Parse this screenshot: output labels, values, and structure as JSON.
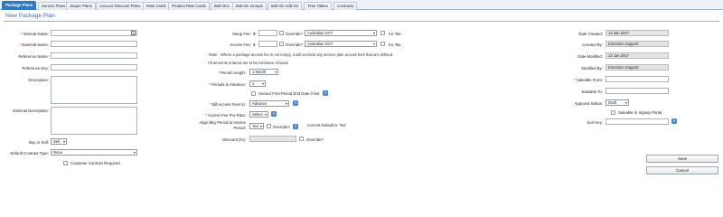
{
  "tabs": [
    "Package Plans",
    "Service Plans",
    "Jasper Plans",
    "Account Discount Plans",
    "Rate Cards",
    "Product Rate Cards",
    "Bolt-Ons",
    "Bolt-On Groups",
    "Bolt-On Add-On",
    "Time Tables",
    "Contracts"
  ],
  "page_title": "New Package Plan",
  "left": {
    "internal_name_label": "Internal Name:",
    "external_name_label": "External Name:",
    "reference_name_label": "Reference Name:",
    "reference_key_label": "Reference Key:",
    "description_label": "Description:",
    "external_description_label": "External Description:",
    "buy_or_sell_label": "Buy or Sell:",
    "buy_or_sell_value": "Sell",
    "default_contract_type_label": "Default Contract Type:",
    "default_contract_type_value": "None",
    "customer_contract_required_label": "Customer Contract Required"
  },
  "middle": {
    "setup_fee_label": "Setup Fee:",
    "access_fee_label": "Access Fee:",
    "currency_symbol": "$",
    "override_label": "Override?",
    "tax_value": "Australian GST",
    "inc_tax_label": "Inc Tax",
    "note_line1": "*Note : Where a package access fee is not empty, it will override any service plan access fees that are defined.",
    "note_line2": "All amounts entered are to be exclusive of taxes",
    "period_length_label": "Period Length:",
    "period_length_value": "1 Month",
    "periods_in_advance_label": "Periods in Advance:",
    "periods_in_advance_value": "1",
    "honour_first_period_label": "Honour First Period End Date if Set",
    "bill_access_fees_label": "Bill Access Fees In:",
    "bill_access_fees_value": "Advance",
    "access_fee_prorata_label": "Access Fee Pro-Rata:",
    "access_fee_prorata_value": "Select",
    "align_bkg_label_1": "Align Bkg Period to Invoice",
    "align_bkg_label_2": "Period:",
    "align_bkg_value": "Yes",
    "current_default_label": "Current Default is 'Yes'",
    "discount_label": "Discount (%):"
  },
  "right": {
    "date_created_label": "Date Created:",
    "date_created_value": "13 Jan 2017",
    "created_by_label": "Created By:",
    "created_by_value": "Emersion Support",
    "date_modified_label": "Date Modified:",
    "date_modified_value": "13 Jan 2017",
    "modified_by_label": "Modified By:",
    "modified_by_value": "Emersion Support",
    "saleable_from_label": "Saleable From:",
    "saleable_to_label": "Saleable To:",
    "approval_status_label": "Approval Status:",
    "approval_status_value": "Draft",
    "saleable_signup_label": "Saleable in Signup Portal",
    "sort_key_label": "Sort Key:"
  },
  "actions": {
    "save_label": "Save",
    "cancel_label": "Cancel"
  },
  "colors": {
    "accent": "#2f79c2",
    "title": "#3c6ea6",
    "required": "#cc0000",
    "readonly_bg": "#e4e4e4"
  },
  "icons": {
    "help": "help-icon",
    "grid": "grid-icon"
  }
}
